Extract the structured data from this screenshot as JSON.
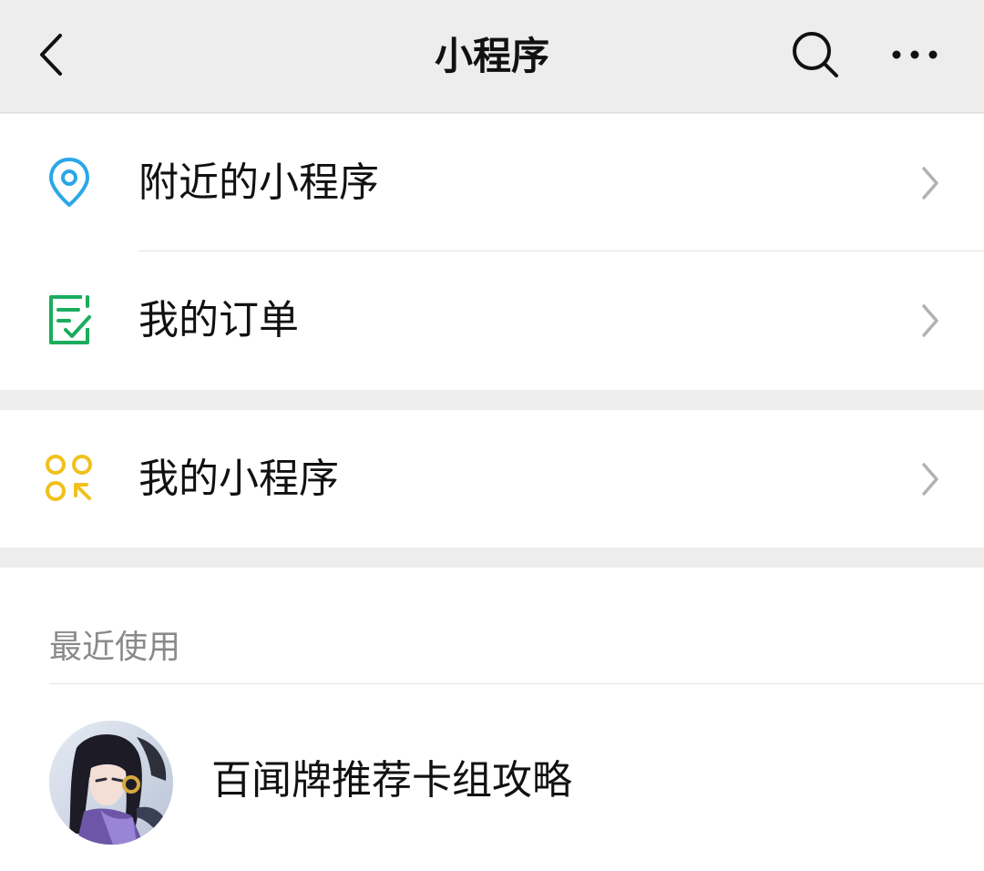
{
  "header": {
    "title": "小程序",
    "back_icon": "chevron-left-icon",
    "search_icon": "search-icon",
    "more_icon": "more-dots-icon"
  },
  "menu": {
    "nearby": {
      "label": "附近的小程序",
      "icon": "location-pin-icon",
      "icon_color": "#2aa7e8"
    },
    "orders": {
      "label": "我的订单",
      "icon": "order-check-icon",
      "icon_color": "#1aad5c"
    },
    "my_programs": {
      "label": "我的小程序",
      "icon": "mini-program-grid-icon",
      "icon_color": "#f0c11c"
    }
  },
  "recent": {
    "title": "最近使用",
    "items": [
      {
        "name": "百闻牌推荐卡组攻略",
        "avatar": "anime-character-avatar"
      }
    ]
  },
  "colors": {
    "background": "#ededed",
    "surface": "#ffffff",
    "text_primary": "#111111",
    "text_secondary": "#8a8a8a",
    "chevron": "#b2b2b2"
  }
}
